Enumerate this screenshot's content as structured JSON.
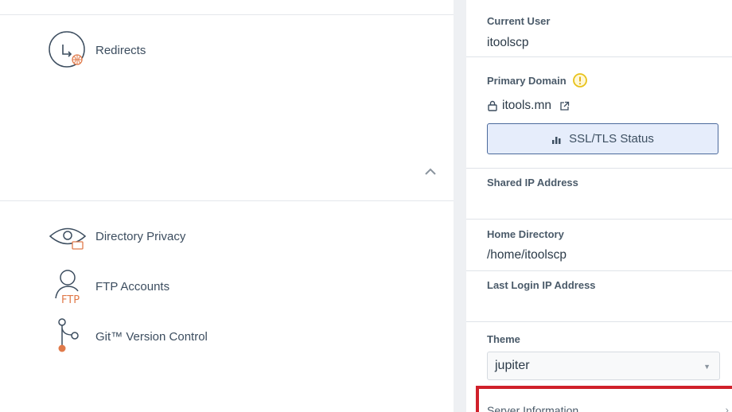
{
  "tools": {
    "redirects": {
      "label": "Redirects",
      "icon": "redirect-globe-icon"
    },
    "directory_privacy": {
      "label": "Directory Privacy",
      "icon": "eye-folder-icon"
    },
    "ftp_accounts": {
      "label": "FTP Accounts",
      "icon": "ftp-user-icon",
      "badge": "FTP"
    },
    "git_version_control": {
      "label": "Git™ Version Control",
      "icon": "git-branch-icon"
    }
  },
  "panel": {
    "current_user": {
      "label": "Current User",
      "value": "itoolscp"
    },
    "primary_domain": {
      "label": "Primary Domain",
      "value": "itools.mn",
      "warning_icon": "warning-circle-icon"
    },
    "ssl_button": {
      "label": "SSL/TLS Status"
    },
    "shared_ip": {
      "label": "Shared IP Address",
      "value": ""
    },
    "home_directory": {
      "label": "Home Directory",
      "value": "/home/itoolscp"
    },
    "last_login_ip": {
      "label": "Last Login IP Address",
      "value": ""
    },
    "theme": {
      "label": "Theme",
      "value": "jupiter"
    },
    "server_information": {
      "label": "Server Information"
    }
  },
  "colors": {
    "accent": "#4c6a9c",
    "icon_orange": "#e07a4a",
    "warning": "#e8c21a",
    "highlight": "#d0202a"
  }
}
